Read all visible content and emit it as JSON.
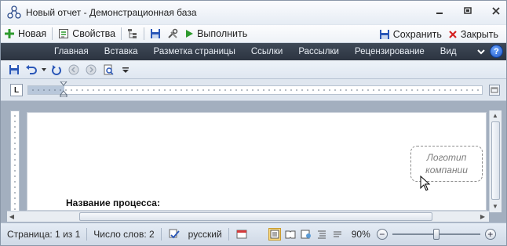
{
  "window": {
    "title": "Новый отчет - Демонстрационная база"
  },
  "commandbar": {
    "new_label": "Новая",
    "properties_label": "Свойства",
    "run_label": "Выполнить",
    "save_label": "Сохранить",
    "close_label": "Закрыть"
  },
  "ribbon": {
    "tabs": [
      "Главная",
      "Вставка",
      "Разметка страницы",
      "Ссылки",
      "Рассылки",
      "Рецензирование",
      "Вид"
    ],
    "help_label": "?"
  },
  "ruler": {
    "tab_selector": "L"
  },
  "document": {
    "logo_placeholder": "Логотип компании",
    "process_label": "Название процесса:"
  },
  "statusbar": {
    "page": "Страница: 1 из 1",
    "word_count": "Число слов: 2",
    "language": "русский",
    "zoom": "90%",
    "zoom_level_fraction": 0.5
  },
  "colors": {
    "ribbon_bg": "#2c3440",
    "accent_green": "#2e9a2e",
    "close_red": "#d42020"
  }
}
